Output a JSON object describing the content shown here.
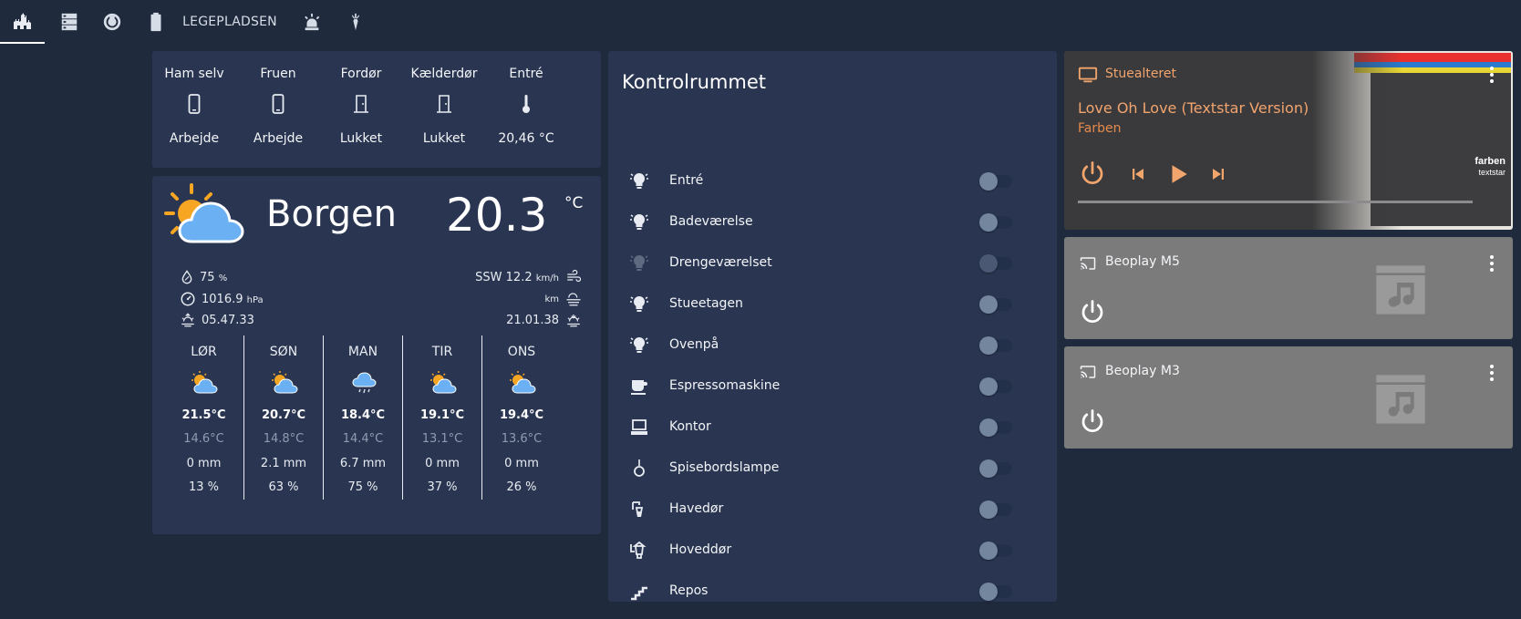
{
  "topbar": {
    "tabs": [
      {
        "icon": "castle-icon",
        "active": true
      },
      {
        "icon": "server-icon"
      },
      {
        "icon": "robot-vacuum-icon"
      },
      {
        "icon": "battery-icon"
      },
      {
        "label": "LEGEPLADSEN"
      },
      {
        "icon": "alarm-light-icon"
      },
      {
        "icon": "carrot-icon"
      }
    ]
  },
  "persons": [
    {
      "name": "Ham selv",
      "icon": "cellphone-icon",
      "state": "Arbejde"
    },
    {
      "name": "Fruen",
      "icon": "cellphone-icon",
      "state": "Arbejde"
    },
    {
      "name": "Fordør",
      "icon": "door-closed-icon",
      "state": "Lukket"
    },
    {
      "name": "Kælderdør",
      "icon": "door-closed-icon",
      "state": "Lukket"
    },
    {
      "name": "Entré",
      "icon": "thermometer-icon",
      "state": "20,46 °C"
    }
  ],
  "weather": {
    "city": "Borgen",
    "temperature": "20.3",
    "unit": "°C",
    "humidity": "75",
    "humidity_unit": "%",
    "pressure": "1016.9",
    "pressure_unit": "hPa",
    "sunrise": "05.47.33",
    "wind": "SSW 12.2",
    "wind_unit": "km/h",
    "visibility_unit": "km",
    "sunset": "21.01.38",
    "forecast": [
      {
        "day": "LØR",
        "high": "21.5°C",
        "low": "14.6°C",
        "rain": "0 mm",
        "prob": "13 %",
        "icon": "partly-sunny-icon"
      },
      {
        "day": "SØN",
        "high": "20.7°C",
        "low": "14.8°C",
        "rain": "2.1 mm",
        "prob": "63 %",
        "icon": "partly-sunny-icon"
      },
      {
        "day": "MAN",
        "high": "18.4°C",
        "low": "14.4°C",
        "rain": "6.7 mm",
        "prob": "75 %",
        "icon": "rain-cloud-icon"
      },
      {
        "day": "TIR",
        "high": "19.1°C",
        "low": "13.1°C",
        "rain": "0 mm",
        "prob": "37 %",
        "icon": "partly-sunny-icon"
      },
      {
        "day": "ONS",
        "high": "19.4°C",
        "low": "13.6°C",
        "rain": "0 mm",
        "prob": "26 %",
        "icon": "partly-sunny-icon"
      }
    ]
  },
  "control": {
    "title": "Kontrolrummet",
    "rows": [
      {
        "label": "Entré",
        "icon": "lightbulb-icon",
        "on": false
      },
      {
        "label": "Badeværelse",
        "icon": "lightbulb-icon",
        "on": false
      },
      {
        "label": "Drengeværelset",
        "icon": "lightbulb-icon",
        "on": false,
        "unavailable": true
      },
      {
        "label": "Stueetagen",
        "icon": "lightbulb-icon",
        "on": false
      },
      {
        "label": "Ovenpå",
        "icon": "lightbulb-icon",
        "on": false
      },
      {
        "label": "Espressomaskine",
        "icon": "coffee-icon",
        "on": false
      },
      {
        "label": "Kontor",
        "icon": "desktop-icon",
        "on": false
      },
      {
        "label": "Spisebordslampe",
        "icon": "ceiling-lamp-icon",
        "on": false
      },
      {
        "label": "Havedør",
        "icon": "outdoor-lamp-icon",
        "on": false
      },
      {
        "label": "Hoveddør",
        "icon": "lantern-icon",
        "on": false
      },
      {
        "label": "Repos",
        "icon": "stairs-icon",
        "on": false
      }
    ]
  },
  "media": {
    "main": {
      "name": "Stuealteret",
      "title": "Love Oh Love (Textstar Version)",
      "artist": "Farben",
      "art_line1": "farben",
      "art_line2": "textstar",
      "progress": 0.0,
      "accent": "#f2a46d"
    },
    "players": [
      {
        "name": "Beoplay M5"
      },
      {
        "name": "Beoplay M3"
      }
    ]
  }
}
